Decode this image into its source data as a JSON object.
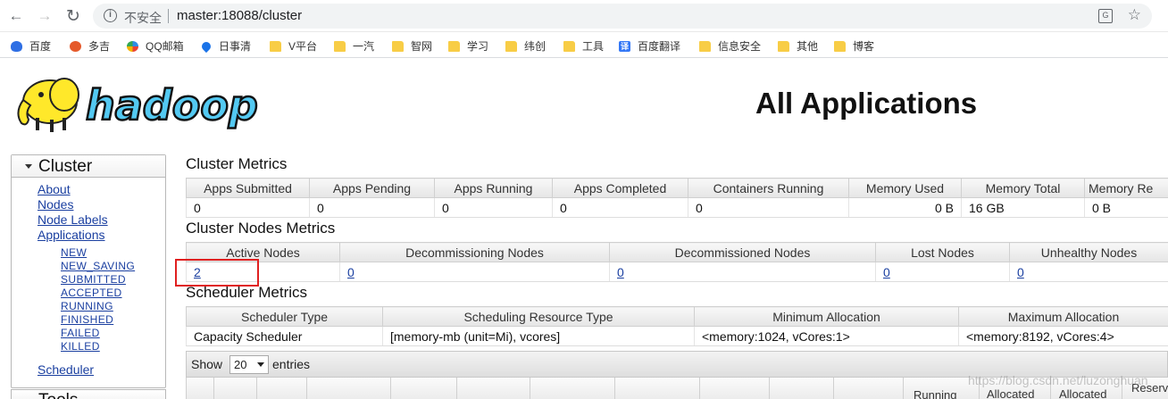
{
  "browser": {
    "insecure_label": "不安全",
    "url": "master:18088/cluster",
    "bookmarks": [
      "百度",
      "多吉",
      "QQ邮箱",
      "日事清",
      "V平台",
      "一汽",
      "智网",
      "学习",
      "纬创",
      "工具",
      "百度翻译",
      "信息安全",
      "其他",
      "博客"
    ],
    "bookmark_icons": [
      "baidu-icon",
      "duoji-icon",
      "qq-mail-icon",
      "pin-icon",
      "folder-icon",
      "folder-icon",
      "folder-icon",
      "folder-icon",
      "folder-icon",
      "folder-icon",
      "fanyi-icon",
      "folder-icon",
      "folder-icon",
      "folder-icon"
    ]
  },
  "page": {
    "logo_text": "hadoop",
    "title": "All Applications"
  },
  "sidebar": {
    "cluster_title": "Cluster",
    "links": [
      "About",
      "Nodes",
      "Node Labels",
      "Applications"
    ],
    "app_states": [
      "NEW",
      "NEW_SAVING",
      "SUBMITTED",
      "ACCEPTED",
      "RUNNING",
      "FINISHED",
      "FAILED",
      "KILLED"
    ],
    "scheduler_link": "Scheduler",
    "tools_title": "Tools"
  },
  "cluster_metrics": {
    "title": "Cluster Metrics",
    "headers": [
      "Apps Submitted",
      "Apps Pending",
      "Apps Running",
      "Apps Completed",
      "Containers Running",
      "Memory Used",
      "Memory Total",
      "Memory Re"
    ],
    "values": [
      "0",
      "0",
      "0",
      "0",
      "0",
      "0 B",
      "16 GB",
      "0 B"
    ]
  },
  "nodes_metrics": {
    "title": "Cluster Nodes Metrics",
    "headers": [
      "Active Nodes",
      "Decommissioning Nodes",
      "Decommissioned Nodes",
      "Lost Nodes",
      "Unhealthy Nodes"
    ],
    "values": [
      "2",
      "0",
      "0",
      "0",
      "0"
    ]
  },
  "scheduler_metrics": {
    "title": "Scheduler Metrics",
    "headers": [
      "Scheduler Type",
      "Scheduling Resource Type",
      "Minimum Allocation",
      "Maximum Allocation"
    ],
    "values": [
      "Capacity Scheduler",
      "[memory-mb (unit=Mi), vcores]",
      "<memory:1024, vCores:1>",
      "<memory:8192, vCores:4>"
    ]
  },
  "apps_table": {
    "show_label": "Show",
    "page_size": "20",
    "entries_label": "entries",
    "partial_headers": [
      "Running",
      "Allocated",
      "Allocated",
      "Reserv"
    ]
  },
  "watermark": "https://blog.csdn.net/luzonghuan",
  "colors": {
    "link": "#1a3fa0",
    "highlight": "#e02020",
    "header_bg": "#e5e5e5"
  }
}
